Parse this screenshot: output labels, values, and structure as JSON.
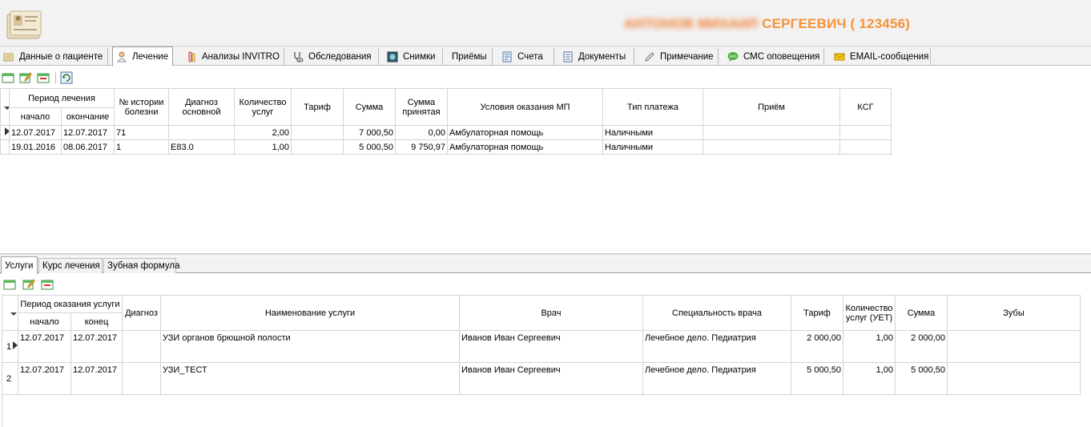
{
  "header": {
    "patient_blurred": "АНТОНОВ МИХАИЛ",
    "patient_visible": "СЕРГЕЕВИЧ ( 123456)"
  },
  "tabs": [
    {
      "label": "Данные о пациенте",
      "icon": "notepad-icon"
    },
    {
      "label": "Лечение",
      "icon": "doctor-icon"
    },
    {
      "label": "Анализы INVITRO",
      "icon": "test-tube-icon"
    },
    {
      "label": "Обследования",
      "icon": "stethoscope-icon"
    },
    {
      "label": "Снимки",
      "icon": "xray-icon"
    },
    {
      "label": "Приёмы",
      "icon": ""
    },
    {
      "label": "Счета",
      "icon": "invoice-icon"
    },
    {
      "label": "Документы",
      "icon": "document-icon"
    },
    {
      "label": "Примечание",
      "icon": "pencil-icon"
    },
    {
      "label": "СМС оповещения",
      "icon": "sms-icon"
    },
    {
      "label": "EMAIL-сообщения",
      "icon": "envelope-icon"
    }
  ],
  "treatment": {
    "headers": {
      "period": "Период лечения",
      "start": "начало",
      "end": "окончание",
      "history": "№ истории болезни",
      "diagnosis": "Диагноз основной",
      "count": "Количество услуг",
      "tariff": "Тариф",
      "sum": "Сумма",
      "sum_accepted": "Сумма принятая",
      "conditions": "Условия оказания МП",
      "payment": "Тип платежа",
      "reception": "Приём",
      "ksg": "КСГ"
    },
    "rows": [
      {
        "start": "12.07.2017",
        "end": "12.07.2017",
        "history": "71",
        "diagnosis": "",
        "count": "2,00",
        "tariff": "",
        "sum": "7 000,50",
        "sum_accepted": "0,00",
        "conditions": "Амбулаторная помощь",
        "payment": "Наличными",
        "reception": "",
        "ksg": ""
      },
      {
        "start": "19.01.2016",
        "end": "08.06.2017",
        "history": "1",
        "diagnosis": "E83.0",
        "count": "1,00",
        "tariff": "",
        "sum": "5 000,50",
        "sum_accepted": "9 750,97",
        "conditions": "Амбулаторная помощь",
        "payment": "Наличными",
        "reception": "",
        "ksg": ""
      }
    ]
  },
  "subtabs": [
    "Услуги",
    "Курс лечения",
    "Зубная формула"
  ],
  "services": {
    "headers": {
      "period": "Период оказания услуги",
      "start": "начало",
      "end": "конец",
      "diagnosis": "Диагноз",
      "name": "Наименование услуги",
      "doctor": "Врач",
      "specialty": "Специальность врача",
      "tariff": "Тариф",
      "count": "Количество услуг (УЕТ)",
      "sum": "Сумма",
      "teeth": "Зубы"
    },
    "rows": [
      {
        "num": "1",
        "start": "12.07.2017",
        "end": "12.07.2017",
        "diagnosis": "",
        "name": "УЗИ органов брюшной полости",
        "doctor": "Иванов Иван Сергеевич",
        "specialty": "Лечебное дело. Педиатрия",
        "tariff": "2 000,00",
        "count": "1,00",
        "sum": "2 000,00",
        "teeth": ""
      },
      {
        "num": "2",
        "start": "12.07.2017",
        "end": "12.07.2017",
        "diagnosis": "",
        "name": "УЗИ_ТЕСТ",
        "doctor": "Иванов Иван Сергеевич",
        "specialty": "Лечебное дело. Педиатрия",
        "tariff": "5 000,50",
        "count": "1,00",
        "sum": "5 000,50",
        "teeth": ""
      }
    ]
  }
}
